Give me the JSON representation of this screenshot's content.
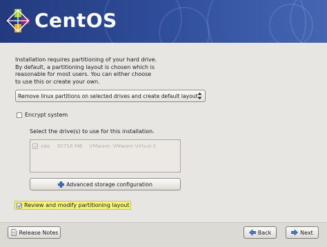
{
  "app": {
    "brand": "CentOS"
  },
  "intro": {
    "text": "Installation requires partitioning of your hard drive.\nBy default, a partitioning layout is chosen which is\nreasonable for most users.  You can either choose\nto use this or create your own."
  },
  "layout_combo": {
    "selected": "Remove linux partitions on selected drives and create default layout."
  },
  "encrypt": {
    "label": "Encrypt system",
    "checked": false
  },
  "drives": {
    "label": "Select the drive(s) to use for this installation.",
    "rows": [
      {
        "checked": true,
        "name": "sda",
        "size": "30718 MB",
        "model": "VMware, VMware Virtual S"
      }
    ]
  },
  "advanced": {
    "label": "Advanced storage configuration",
    "icon": "plus-icon"
  },
  "review": {
    "label": "Review and modify partitioning layout",
    "checked": true
  },
  "buttons": {
    "release_notes": "Release Notes",
    "back": "Back",
    "next": "Next"
  },
  "colors": {
    "banner": "#2f4d9a",
    "highlight": "#f6f27a",
    "background": "#e8e6e2"
  }
}
